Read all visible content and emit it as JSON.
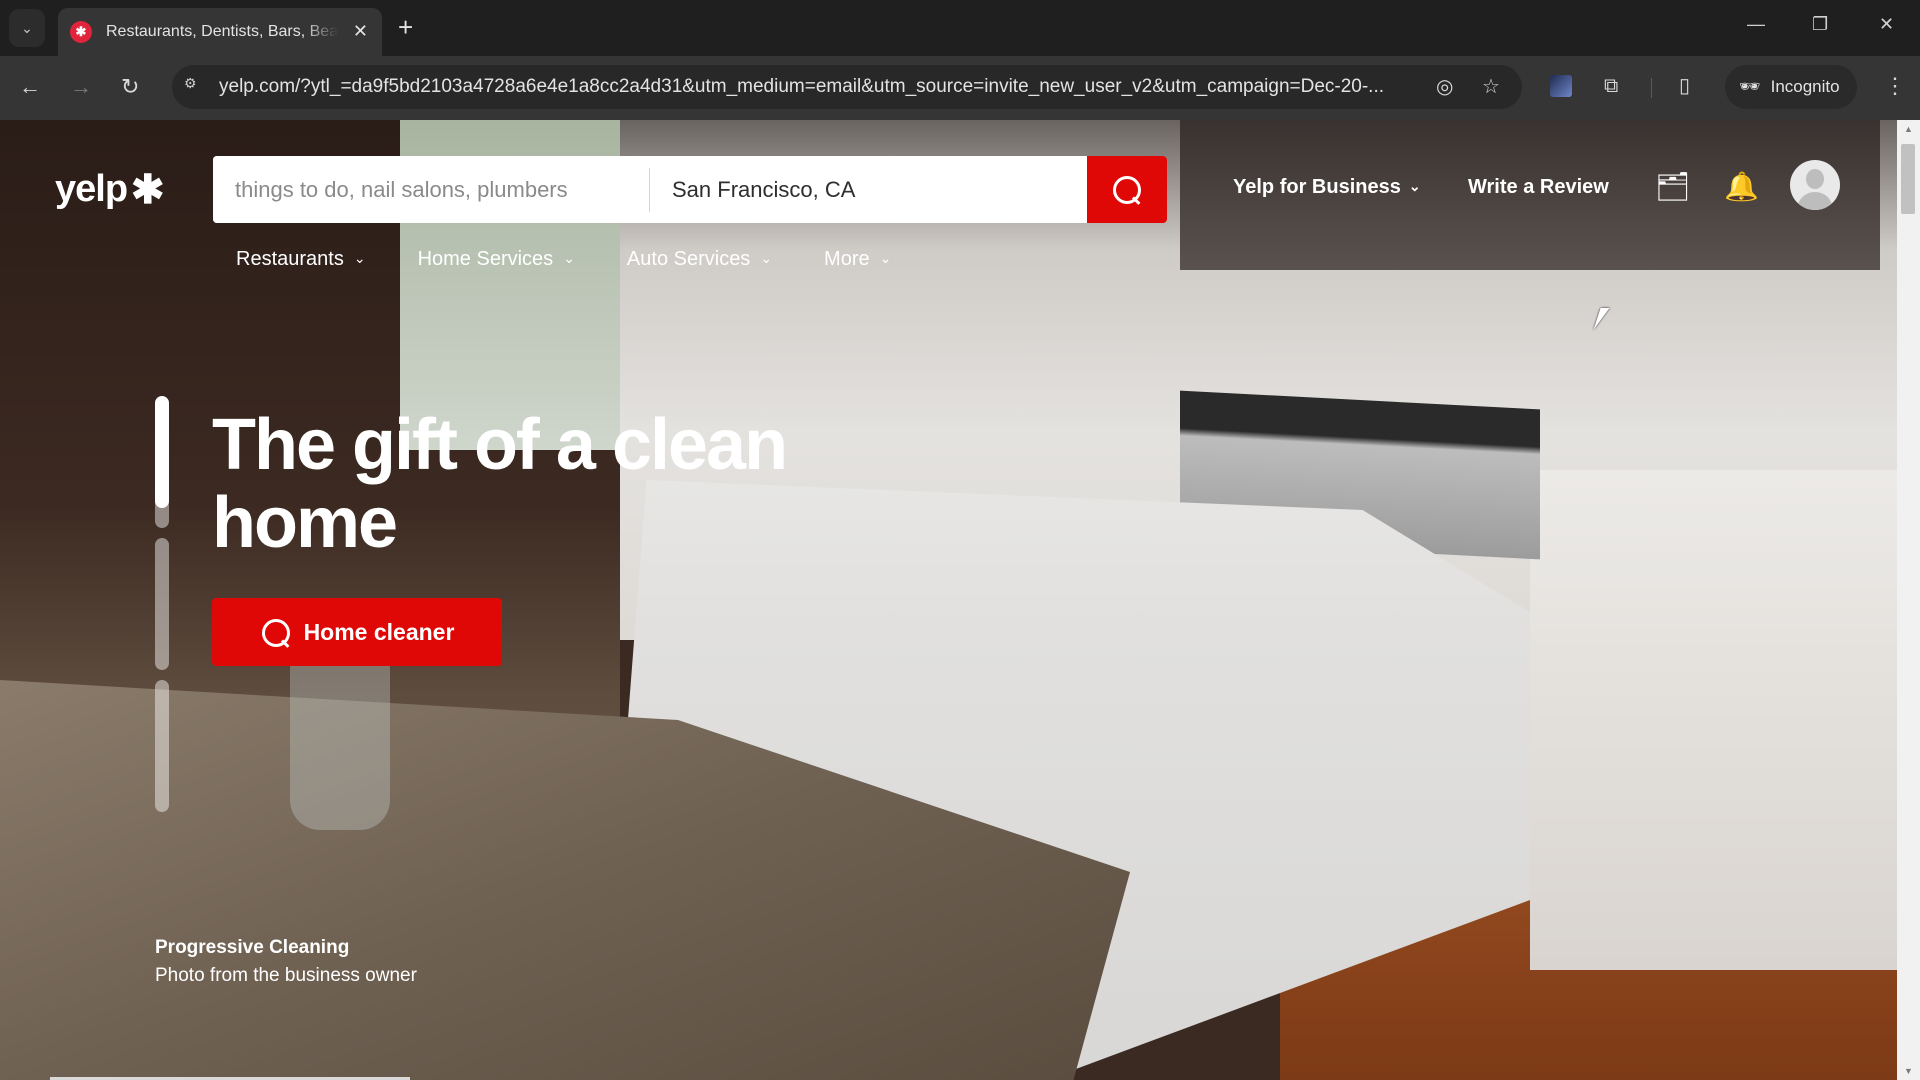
{
  "browser": {
    "tab": {
      "title": "Restaurants, Dentists, Bars, Beauty Salons, Doctors - Yelp",
      "favicon": "yelp-burst-icon",
      "close_glyph": "✕"
    },
    "new_tab_glyph": "+",
    "tab_search_glyph": "⌄",
    "window_controls": {
      "minimize": "—",
      "restore": "❐",
      "close": "✕"
    },
    "nav": {
      "back": "←",
      "forward": "→",
      "reload": "↻"
    },
    "url": "yelp.com/?ytl_=da9f5bd2103a4728a6e4e1a8cc2a4d31&utm_medium=email&utm_source=invite_new_user_v2&utm_campaign=Dec-20-...",
    "site_info_glyph": "⚙",
    "omnibox_icons": {
      "tracking_protection": "◎",
      "bookmark": "☆"
    },
    "toolbar_icons": {
      "extensions": "⧉",
      "side_panel": "▯",
      "menu": "⋮"
    },
    "incognito": {
      "glyph": "🕶",
      "label": "Incognito"
    }
  },
  "yelp": {
    "brand_color": "#e00707",
    "logo": {
      "text": "yelp",
      "burst": "✱"
    },
    "search": {
      "find_placeholder": "things to do, nail salons, plumbers",
      "find_value": "",
      "location_value": "San Francisco, CA",
      "button": "search-icon"
    },
    "header_links": {
      "business": "Yelp for Business",
      "write_review": "Write a Review"
    },
    "header_icons": {
      "projects": "🗂",
      "notifications": "🔔"
    },
    "chevron": "⌄",
    "categories": [
      {
        "label": "Restaurants"
      },
      {
        "label": "Home Services"
      },
      {
        "label": "Auto Services"
      },
      {
        "label": "More"
      }
    ],
    "hero": {
      "title": "The gift of a clean home",
      "cta_label": "Home cleaner",
      "slides_progress": [
        0.85,
        0,
        0
      ],
      "caption_business": "Progressive Cleaning",
      "caption_sub": "Photo from the business owner"
    }
  },
  "scrollbars": {
    "vertical_arrow_up": "▲",
    "vertical_arrow_down": "▼"
  }
}
